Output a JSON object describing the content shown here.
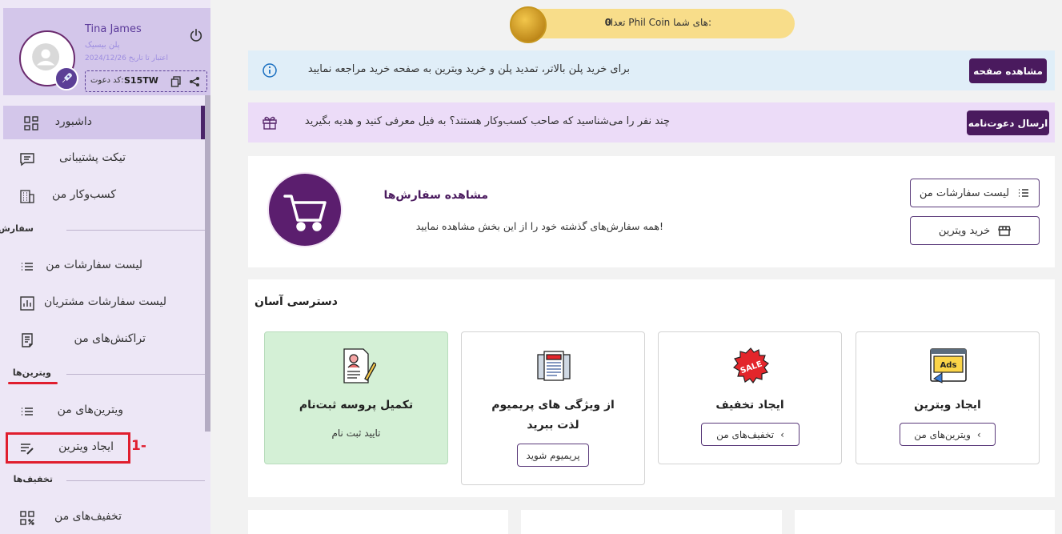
{
  "profile": {
    "name": "Tina James",
    "plan": "پلن بیسیک",
    "validity_label": "اعتبار تا تاریخ",
    "validity_date": "2024/12/26",
    "invite_label": "کد دعوت:",
    "invite_code": "S15TW"
  },
  "sidebar": {
    "dashboard": "داشبورد",
    "support": "تیکت پشتیبانی",
    "business": "کسب‌وکار من",
    "section_orders": "سفارش‌ها",
    "my_orders": "لیست سفارشات من",
    "customer_orders": "لیست سفارشات مشتریان",
    "transactions": "تراکنش‌های من",
    "section_showcases": "ویترین‌ها",
    "my_showcases": "ویترین‌های من",
    "create_showcase": "ایجاد ویترین",
    "section_discounts": "تخفیف‌ها",
    "my_discounts": "تخفیف‌های من"
  },
  "annotation": "1-",
  "coin": {
    "label": "تعداد Phil Coin های شما:",
    "value": "0"
  },
  "banner_plan": {
    "text": "برای خرید پلن بالاتر، تمدید پلن و خرید ویترین به صفحه خرید مراجعه نمایید",
    "button": "مشاهده صفحه"
  },
  "banner_invite": {
    "text": "چند نفر را می‌شناسید که صاحب کسب‌وکار هستند؟ به فیل معرفی کنید و هدیه بگیرید",
    "button": "ارسال دعوت‌نامه"
  },
  "orders_card": {
    "title": "مشاهده سفارش‌ها",
    "subtitle": "همه سفارش‌های گذشته خود را از این بخش مشاهده نمایید!",
    "btn_list": "لیست سفارشات من",
    "btn_buy": "خرید ویترین"
  },
  "quick_access": {
    "title": "دسترسی آسان",
    "cards": [
      {
        "title": "ایجاد ویترین",
        "button": "ویترین‌های من",
        "icon": "ads-icon"
      },
      {
        "title": "ایجاد تخفیف",
        "button": "تخفیف‌های من",
        "icon": "sale-icon"
      },
      {
        "title": "از ویژگی های پریمیوم لذت ببرید",
        "button": "پریمیوم شوید",
        "icon": "newspaper-icon"
      },
      {
        "title": "تکمیل پروسه ثبت‌نام",
        "subtitle": "تایید ثبت نام",
        "icon": "resume-icon"
      }
    ]
  },
  "colors": {
    "primary": "#4a1a5e",
    "sidebar_bg": "#ede7f6",
    "accent_red": "#e01e2e",
    "coin_bg": "#f8dd8a"
  }
}
